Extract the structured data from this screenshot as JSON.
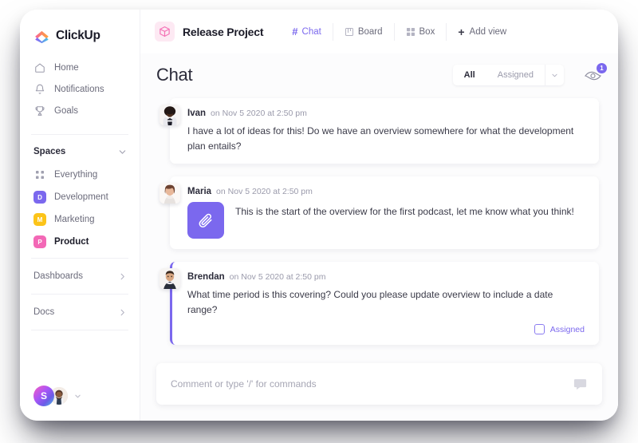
{
  "brand": {
    "name": "ClickUp",
    "logo_icon": "clickup-logo-icon"
  },
  "sidebar": {
    "nav": [
      {
        "label": "Home",
        "icon": "home-icon"
      },
      {
        "label": "Notifications",
        "icon": "bell-icon"
      },
      {
        "label": "Goals",
        "icon": "trophy-icon"
      }
    ],
    "spaces_section": {
      "label": "Spaces",
      "chevron": "chevron-down-icon"
    },
    "spaces": [
      {
        "label": "Everything",
        "icon": "grid-icon",
        "badge": "",
        "color": "",
        "active": false
      },
      {
        "label": "Development",
        "icon": "space-badge",
        "badge": "D",
        "color": "#7b68ee",
        "active": false
      },
      {
        "label": "Marketing",
        "icon": "space-badge",
        "badge": "M",
        "color": "#fcc419",
        "active": false
      },
      {
        "label": "Product",
        "icon": "space-badge",
        "badge": "P",
        "color": "#f368b6",
        "active": true
      }
    ],
    "footer_nav": [
      {
        "label": "Dashboards",
        "chevron": "chevron-right-icon"
      },
      {
        "label": "Docs",
        "chevron": "chevron-right-icon"
      }
    ],
    "account": {
      "workspace_initial": "S",
      "workspace_avatar": "workspace-avatar",
      "user_avatar": "user-avatar",
      "caret": "chevron-down-icon"
    }
  },
  "topbar": {
    "project_icon": "cube-icon",
    "project_title": "Release Project",
    "views": [
      {
        "label": "Chat",
        "icon": "hash-icon",
        "active": true
      },
      {
        "label": "Board",
        "icon": "board-icon",
        "active": false
      },
      {
        "label": "Box",
        "icon": "box-icon",
        "active": false
      }
    ],
    "add_view_label": "Add view",
    "add_view_icon": "plus-icon"
  },
  "chat": {
    "title": "Chat",
    "filters": [
      {
        "label": "All",
        "active": true
      },
      {
        "label": "Assigned",
        "active": false
      }
    ],
    "filter_caret": "chevron-down-icon",
    "watch_icon": "eye-icon",
    "watch_count": "1"
  },
  "messages": [
    {
      "author": "Ivan",
      "time": "on Nov 5 2020 at 2:50 pm",
      "text": "I have a lot of ideas for this! Do we have an overview somewhere for what the development plan entails?",
      "avatar": "avatar-ivan",
      "has_attachment": false,
      "flagged": false,
      "assigned": false
    },
    {
      "author": "Maria",
      "time": "on Nov 5 2020 at 2:50 pm",
      "text": "This is the start of the overview for the first podcast, let me know what you think!",
      "avatar": "avatar-maria",
      "has_attachment": true,
      "attachment_icon": "paperclip-icon",
      "flagged": false,
      "assigned": false
    },
    {
      "author": "Brendan",
      "time": "on Nov 5 2020 at 2:50 pm",
      "text": "What time period is this covering? Could you please update overview to include a date range?",
      "avatar": "avatar-brendan",
      "has_attachment": false,
      "flagged": true,
      "assigned": true,
      "assigned_label": "Assigned"
    }
  ],
  "composer": {
    "placeholder": "Comment or type '/' for commands",
    "icon": "comment-bubble-icon"
  },
  "colors": {
    "accent": "#7b68ee",
    "brand_pink": "#f368b6",
    "text_dark": "#2b2b3a",
    "text_muted": "#9a9aab"
  }
}
